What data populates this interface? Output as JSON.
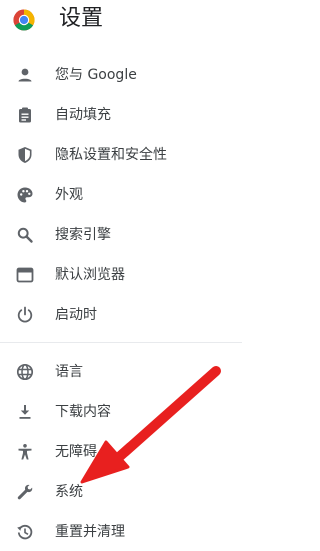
{
  "header": {
    "title": "设置",
    "logo": "chrome-logo"
  },
  "nav": {
    "items": [
      {
        "label": "您与 Google",
        "icon": "person-icon"
      },
      {
        "label": "自动填充",
        "icon": "clipboard-icon"
      },
      {
        "label": "隐私设置和安全性",
        "icon": "shield-icon"
      },
      {
        "label": "外观",
        "icon": "palette-icon"
      },
      {
        "label": "搜索引擎",
        "icon": "search-icon"
      },
      {
        "label": "默认浏览器",
        "icon": "browser-window-icon"
      },
      {
        "label": "启动时",
        "icon": "power-icon"
      },
      {
        "label": "语言",
        "icon": "globe-icon"
      },
      {
        "label": "下载内容",
        "icon": "download-icon"
      },
      {
        "label": "无障碍",
        "icon": "accessibility-icon"
      },
      {
        "label": "系统",
        "icon": "wrench-icon"
      },
      {
        "label": "重置并清理",
        "icon": "history-icon"
      }
    ]
  },
  "colors": {
    "icon": "#5f6368",
    "text": "#3c4043",
    "annotation_arrow": "#e8201f"
  }
}
